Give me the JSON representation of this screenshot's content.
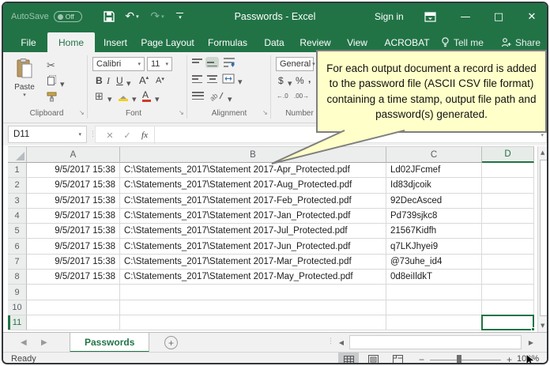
{
  "window": {
    "autosave_label": "AutoSave",
    "autosave_state": "Off",
    "title": "Passwords  -  Excel",
    "sign_in": "Sign in",
    "tell_me": "Tell me",
    "share": "Share",
    "minimize": "—",
    "maximize": "□",
    "close": "✕"
  },
  "menu_tabs": [
    {
      "label": "File",
      "active": false
    },
    {
      "label": "Home",
      "active": true
    },
    {
      "label": "Insert",
      "active": false
    },
    {
      "label": "Page Layout",
      "active": false
    },
    {
      "label": "Formulas",
      "active": false
    },
    {
      "label": "Data",
      "active": false
    },
    {
      "label": "Review",
      "active": false
    },
    {
      "label": "View",
      "active": false
    },
    {
      "label": "ACROBAT",
      "active": false
    }
  ],
  "ribbon": {
    "clipboard_label": "Clipboard",
    "paste_label": "Paste",
    "font_label": "Font",
    "font_name": "Calibri",
    "font_size": "11",
    "bold": "B",
    "italic": "I",
    "underline": "U",
    "grow_font": "A",
    "shrink_font": "A",
    "font_color_letter": "A",
    "alignment_label": "Alignment",
    "number_label": "Number",
    "number_format": "General",
    "currency": "$",
    "percent": "%",
    "comma": ",",
    "inc_decimal": "←.0",
    "dec_decimal": ".00→"
  },
  "callout": {
    "text": "For each output document a record is added to the password file (ASCII CSV file format) containing a time stamp, output file path and password(s) generated."
  },
  "formula": {
    "name_box": "D11",
    "cancel": "✕",
    "enter": "✓",
    "fx": "fx",
    "value": ""
  },
  "grid": {
    "columns": [
      "A",
      "B",
      "C",
      "D"
    ],
    "selected_cell": "D11",
    "rows": [
      {
        "n": "1",
        "a": "9/5/2017 15:38",
        "b": "C:\\Statements_2017\\Statement 2017-Apr_Protected.pdf",
        "c": "Ld02JFcmef"
      },
      {
        "n": "2",
        "a": "9/5/2017 15:38",
        "b": "C:\\Statements_2017\\Statement 2017-Aug_Protected.pdf",
        "c": "Id83djcoik"
      },
      {
        "n": "3",
        "a": "9/5/2017 15:38",
        "b": "C:\\Statements_2017\\Statement 2017-Feb_Protected.pdf",
        "c": "92DecAsced"
      },
      {
        "n": "4",
        "a": "9/5/2017 15:38",
        "b": "C:\\Statements_2017\\Statement 2017-Jan_Protected.pdf",
        "c": "Pd739sjkc8"
      },
      {
        "n": "5",
        "a": "9/5/2017 15:38",
        "b": "C:\\Statements_2017\\Statement 2017-Jul_Protected.pdf",
        "c": "21567Kidfh"
      },
      {
        "n": "6",
        "a": "9/5/2017 15:38",
        "b": "C:\\Statements_2017\\Statement 2017-Jun_Protected.pdf",
        "c": "q7LKJhyei9"
      },
      {
        "n": "7",
        "a": "9/5/2017 15:38",
        "b": "C:\\Statements_2017\\Statement 2017-Mar_Protected.pdf",
        "c": "@73uhe_id4"
      },
      {
        "n": "8",
        "a": "9/5/2017 15:38",
        "b": "C:\\Statements_2017\\Statement 2017-May_Protected.pdf",
        "c": "0d8eiIldkT"
      },
      {
        "n": "9",
        "a": "",
        "b": "",
        "c": ""
      },
      {
        "n": "10",
        "a": "",
        "b": "",
        "c": ""
      },
      {
        "n": "11",
        "a": "",
        "b": "",
        "c": ""
      }
    ]
  },
  "sheet_bar": {
    "tab": "Passwords",
    "add": "+"
  },
  "status_bar": {
    "ready": "Ready",
    "zoom_pct": "100%",
    "zoom_minus": "−",
    "zoom_plus": "+"
  },
  "colors": {
    "accent_green": "#217346",
    "callout_yellow": "#ffffc9",
    "fill_yellow": "#f3d11c",
    "font_red": "#d03a2b"
  }
}
